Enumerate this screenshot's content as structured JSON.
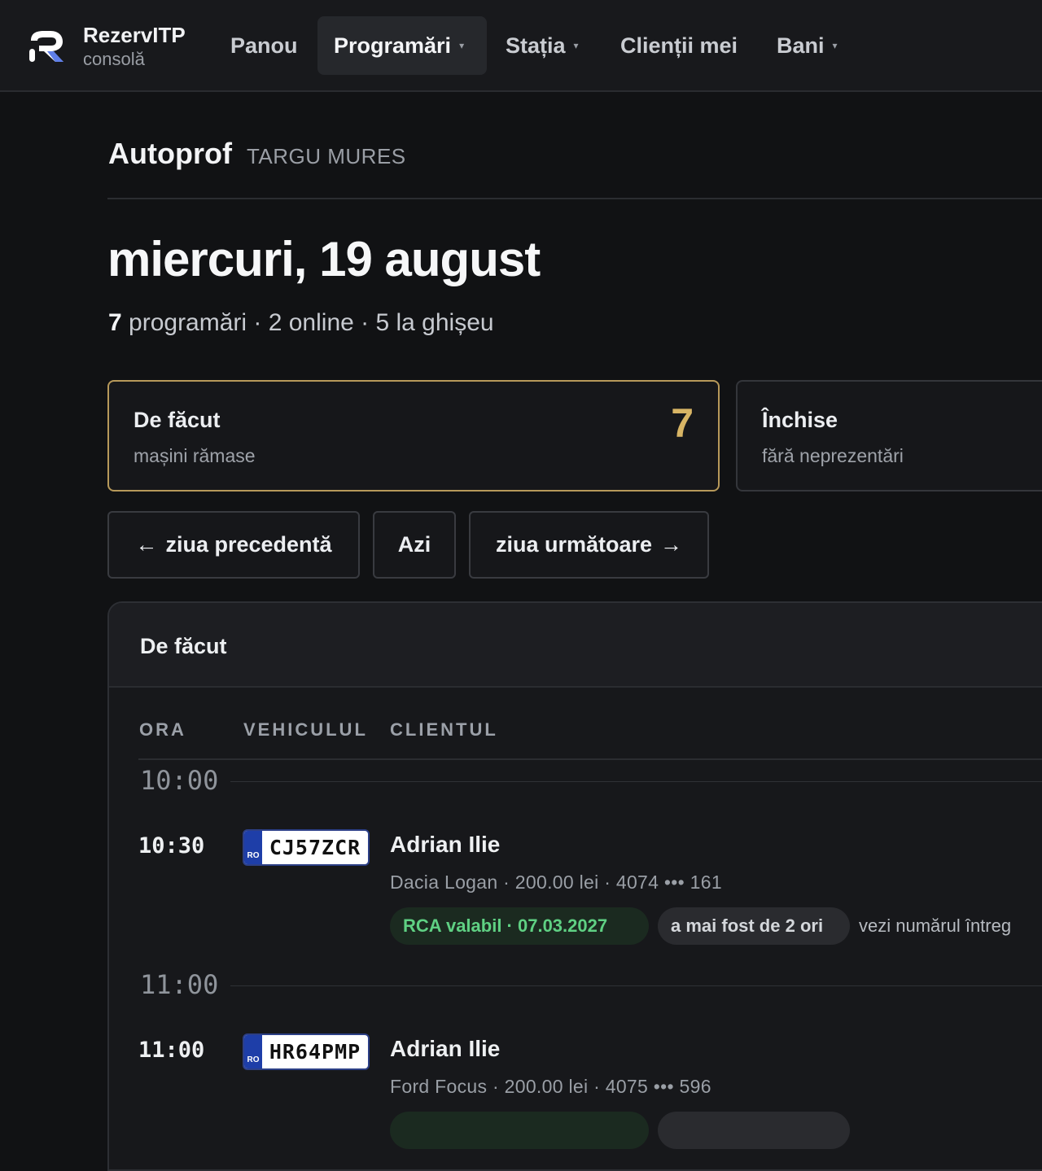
{
  "brand": {
    "name": "RezervITP",
    "sub": "consolă"
  },
  "nav": {
    "panou": "Panou",
    "programari": "Programări",
    "statia": "Stația",
    "clienti": "Clienții mei",
    "bani": "Bani",
    "caret": "▾"
  },
  "station": {
    "name": "Autoprof",
    "city": "TARGU MURES"
  },
  "day": {
    "title": "miercuri, 19 august",
    "count": "7",
    "summary_rest": " programări · 2 online · 5 la ghișeu"
  },
  "cards": {
    "todo": {
      "title": "De făcut",
      "sub": "mașini rămase",
      "value": "7"
    },
    "closed": {
      "title": "Închise",
      "sub": "fără neprezentări"
    }
  },
  "buttons": {
    "prev": "ziua precedentă",
    "prev_arrow": "←",
    "today": "Azi",
    "next": "ziua următoare",
    "next_arrow": "→"
  },
  "panel": {
    "title": "De făcut",
    "columns": {
      "time": "ORA",
      "vehicle": "VEHICULUL",
      "client": "CLIENTUL"
    }
  },
  "hours": [
    "10:00",
    "11:00"
  ],
  "appointments": [
    {
      "time": "10:30",
      "plate_country": "RO",
      "plate": "CJ57ZCR",
      "client": "Adrian Ilie",
      "meta": "Dacia Logan · 200.00 lei · 4074 ••• 161",
      "rca": "RCA valabil · 07.03.2027",
      "visits": "a mai fost de 2 ori",
      "link": "vezi numărul întreg"
    },
    {
      "time": "11:00",
      "plate_country": "RO",
      "plate": "HR64PMP",
      "client": "Adrian Ilie",
      "meta": "Ford Focus · 200.00 lei · 4075 ••• 596"
    }
  ]
}
